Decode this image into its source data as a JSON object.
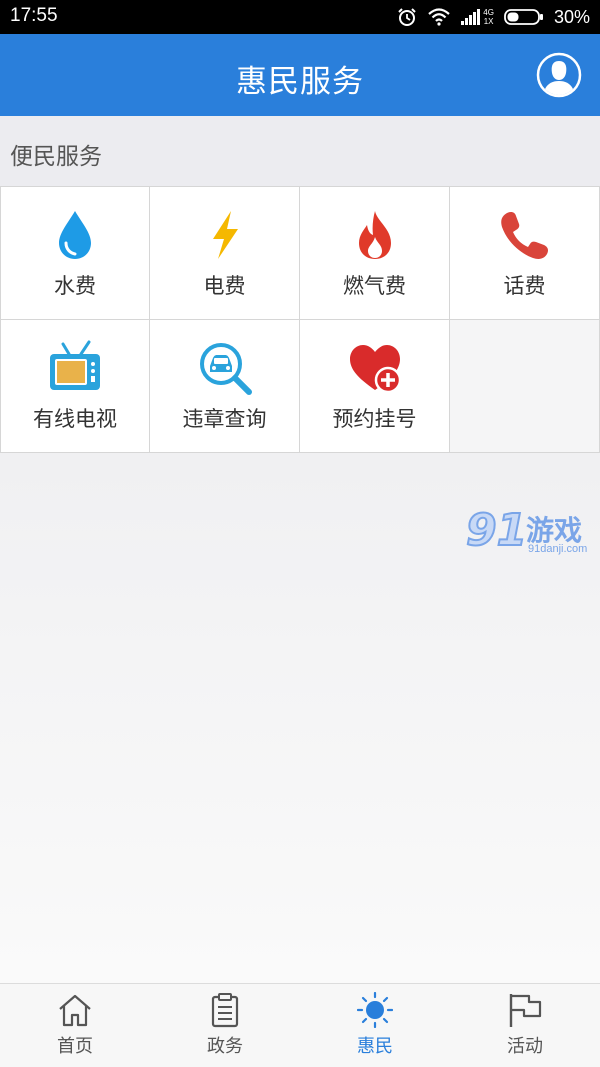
{
  "status_bar": {
    "time": "17:55",
    "net_top": "4G",
    "net_bottom": "1X",
    "battery": "30%"
  },
  "header": {
    "title": "惠民服务",
    "avatar_icon": "user-avatar-icon"
  },
  "section": {
    "title": "便民服务"
  },
  "services": [
    {
      "label": "水费",
      "icon": "water-drop-icon",
      "color": "#1e9be6"
    },
    {
      "label": "电费",
      "icon": "lightning-icon",
      "color": "#f5b800"
    },
    {
      "label": "燃气费",
      "icon": "flame-icon",
      "color": "#e03a2a"
    },
    {
      "label": "话费",
      "icon": "phone-icon",
      "color": "#d9443a"
    },
    {
      "label": "有线电视",
      "icon": "tv-icon",
      "color": "#2aa3dc"
    },
    {
      "label": "违章查询",
      "icon": "car-search-icon",
      "color": "#2aa3dc"
    },
    {
      "label": "预约挂号",
      "icon": "heart-plus-icon",
      "color": "#d92b2b"
    }
  ],
  "watermark": {
    "number": "91",
    "text": "游戏",
    "url": "91danji.com"
  },
  "tabs": [
    {
      "label": "首页",
      "icon": "home-icon",
      "active": false
    },
    {
      "label": "政务",
      "icon": "clipboard-icon",
      "active": false
    },
    {
      "label": "惠民",
      "icon": "sun-icon",
      "active": true
    },
    {
      "label": "活动",
      "icon": "flag-icon",
      "active": false
    }
  ],
  "colors": {
    "primary": "#2a7fdb",
    "tab_inactive": "#555555"
  }
}
